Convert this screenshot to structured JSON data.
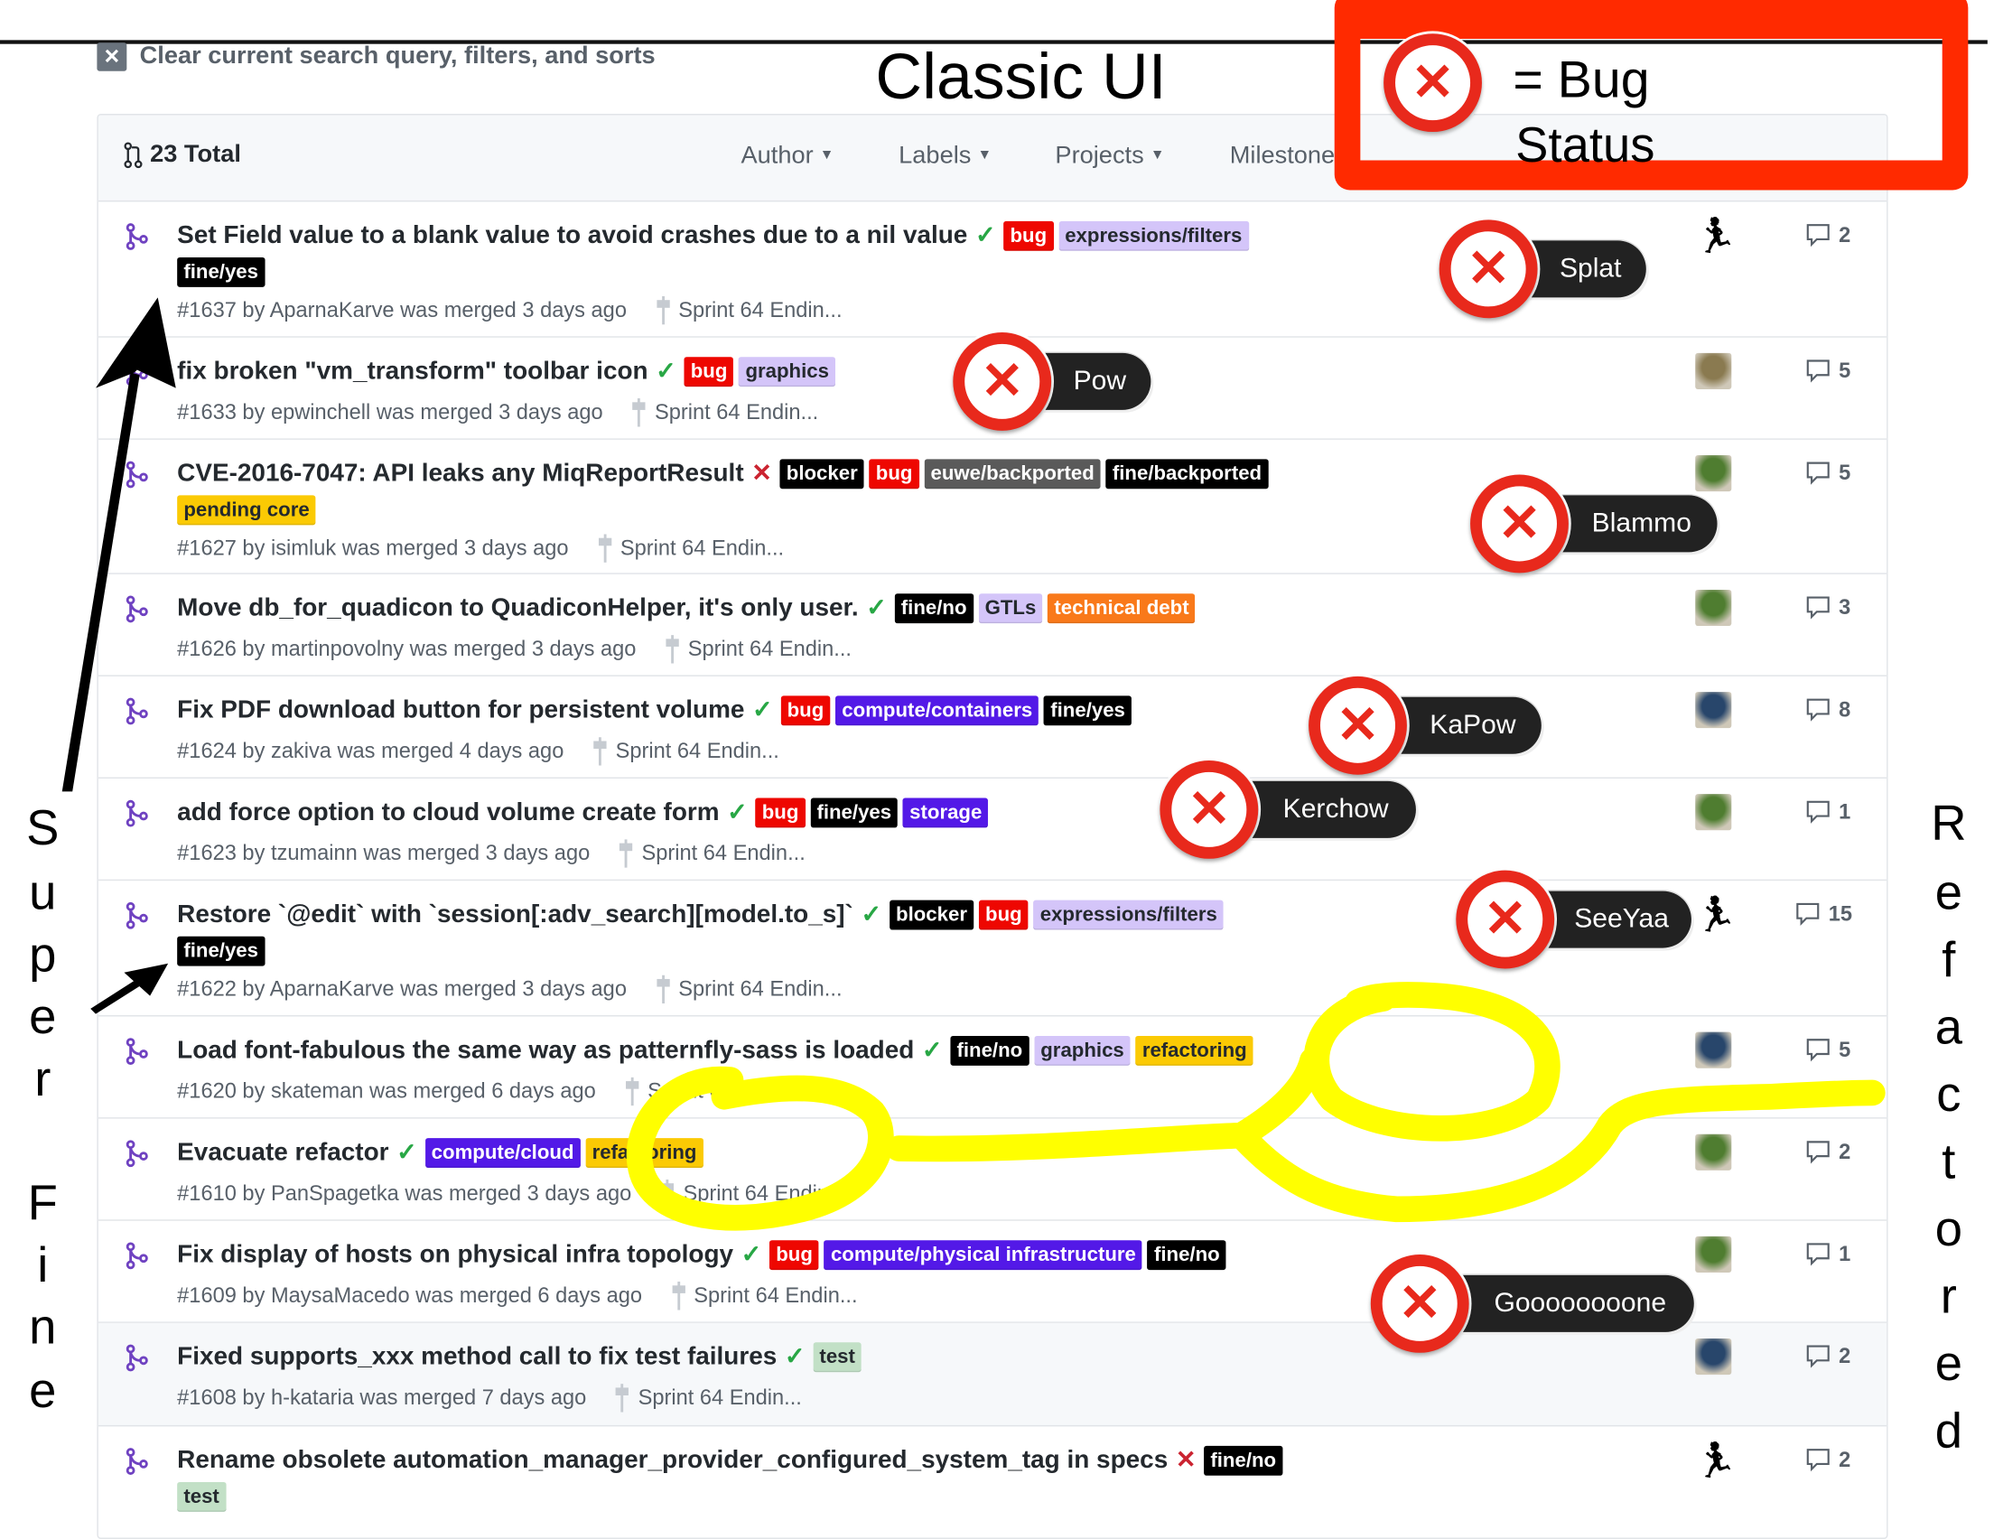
{
  "toolbar": {
    "clear_label": "Clear current search query, filters, and sorts",
    "clear_icon": "x-icon"
  },
  "annotation_title": "Classic UI",
  "legend": {
    "equals_label": "= Bug",
    "status_label": "Status",
    "color": "#ff2a00"
  },
  "header": {
    "total": "23 Total",
    "filters": [
      "Author",
      "Labels",
      "Projects",
      "Milestone"
    ]
  },
  "milestone": "Sprint 64 Endin...",
  "status_colors": {
    "success": "#28a745",
    "failure": "#cb2431"
  },
  "rows": [
    {
      "title": "Set Field value to a blank value to avoid crashes due to a nil value",
      "status": "success",
      "labels": [
        {
          "name": "bug",
          "bg": "#ee0701",
          "fg": "#fff"
        },
        {
          "name": "expressions/filters",
          "bg": "#d4c5f9",
          "fg": "#24292e"
        },
        {
          "name": "fine/yes",
          "bg": "#000000",
          "fg": "#fff"
        }
      ],
      "meta": "#1637 by AparnaKarve was merged 3 days ago",
      "avatar": "runner-icon",
      "comments": "2"
    },
    {
      "title": "fix broken \"vm_transform\" toolbar icon",
      "status": "success",
      "labels": [
        {
          "name": "bug",
          "bg": "#ee0701",
          "fg": "#fff"
        },
        {
          "name": "graphics",
          "bg": "#d4c5f9",
          "fg": "#24292e"
        }
      ],
      "meta": "#1633 by epwinchell was merged 3 days ago",
      "avatar": "photo",
      "comments": "5"
    },
    {
      "title": "CVE-2016-7047: API leaks any MiqReportResult",
      "status": "failure",
      "labels": [
        {
          "name": "blocker",
          "bg": "#000000",
          "fg": "#fff"
        },
        {
          "name": "bug",
          "bg": "#ee0701",
          "fg": "#fff"
        },
        {
          "name": "euwe/backported",
          "bg": "#5a5a5a",
          "fg": "#fff"
        },
        {
          "name": "fine/backported",
          "bg": "#000000",
          "fg": "#fff"
        },
        {
          "name": "pending core",
          "bg": "#fbca04",
          "fg": "#24292e"
        }
      ],
      "meta": "#1627 by isimluk was merged 3 days ago",
      "avatar": "photo",
      "comments": "5"
    },
    {
      "title": "Move db_for_quadicon to QuadiconHelper, it's only user.",
      "status": "success",
      "labels": [
        {
          "name": "fine/no",
          "bg": "#000000",
          "fg": "#fff"
        },
        {
          "name": "GTLs",
          "bg": "#d4c5f9",
          "fg": "#24292e"
        },
        {
          "name": "technical debt",
          "bg": "#f9791a",
          "fg": "#fff"
        }
      ],
      "meta": "#1626 by martinpovolny was merged 3 days ago",
      "avatar": "photo",
      "comments": "3"
    },
    {
      "title": "Fix PDF download button for persistent volume",
      "status": "success",
      "labels": [
        {
          "name": "bug",
          "bg": "#ee0701",
          "fg": "#fff"
        },
        {
          "name": "compute/containers",
          "bg": "#5319e7",
          "fg": "#fff"
        },
        {
          "name": "fine/yes",
          "bg": "#000000",
          "fg": "#fff"
        }
      ],
      "meta": "#1624 by zakiva was merged 4 days ago",
      "avatar": "photo",
      "comments": "8"
    },
    {
      "title": "add force option to cloud volume create form",
      "status": "success",
      "labels": [
        {
          "name": "bug",
          "bg": "#ee0701",
          "fg": "#fff"
        },
        {
          "name": "fine/yes",
          "bg": "#000000",
          "fg": "#fff"
        },
        {
          "name": "storage",
          "bg": "#5319e7",
          "fg": "#fff"
        }
      ],
      "meta": "#1623 by tzumainn was merged 3 days ago",
      "avatar": "photo",
      "comments": "1"
    },
    {
      "title": "Restore `@edit` with `session[:adv_search][model.to_s]`",
      "status": "success",
      "labels": [
        {
          "name": "blocker",
          "bg": "#000000",
          "fg": "#fff"
        },
        {
          "name": "bug",
          "bg": "#ee0701",
          "fg": "#fff"
        },
        {
          "name": "expressions/filters",
          "bg": "#d4c5f9",
          "fg": "#24292e"
        },
        {
          "name": "fine/yes",
          "bg": "#000000",
          "fg": "#fff"
        }
      ],
      "meta": "#1622 by AparnaKarve was merged 3 days ago",
      "avatar": "runner-icon",
      "comments": "15"
    },
    {
      "title": "Load font-fabulous the same way as patternfly-sass is loaded",
      "status": "success",
      "labels": [
        {
          "name": "fine/no",
          "bg": "#000000",
          "fg": "#fff"
        },
        {
          "name": "graphics",
          "bg": "#d4c5f9",
          "fg": "#24292e"
        },
        {
          "name": "refactoring",
          "bg": "#fbca04",
          "fg": "#24292e"
        }
      ],
      "meta": "#1620 by skateman was merged 6 days ago",
      "avatar": "photo",
      "comments": "5"
    },
    {
      "title": "Evacuate refactor",
      "status": "success",
      "labels": [
        {
          "name": "compute/cloud",
          "bg": "#5319e7",
          "fg": "#fff"
        },
        {
          "name": "refactoring",
          "bg": "#fbca04",
          "fg": "#24292e"
        }
      ],
      "meta": "#1610 by PanSpagetka was merged 3 days ago",
      "avatar": "photo",
      "comments": "2"
    },
    {
      "title": "Fix display of hosts on physical infra topology",
      "status": "success",
      "labels": [
        {
          "name": "bug",
          "bg": "#ee0701",
          "fg": "#fff"
        },
        {
          "name": "compute/physical infrastructure",
          "bg": "#5319e7",
          "fg": "#fff"
        },
        {
          "name": "fine/no",
          "bg": "#000000",
          "fg": "#fff"
        }
      ],
      "meta": "#1609 by MaysaMacedo was merged 6 days ago",
      "avatar": "photo",
      "comments": "1"
    },
    {
      "title": "Fixed supports_xxx method call to fix test failures",
      "status": "success",
      "labels": [
        {
          "name": "test",
          "bg": "#c2e0c6",
          "fg": "#24292e"
        }
      ],
      "meta": "#1608 by h-kataria was merged 7 days ago",
      "avatar": "photo",
      "comments": "2"
    },
    {
      "title": "Rename obsolete automation_manager_provider_configured_system_tag in specs",
      "status": "failure",
      "labels": [
        {
          "name": "fine/no",
          "bg": "#000000",
          "fg": "#fff"
        },
        {
          "name": "test",
          "bg": "#c2e0c6",
          "fg": "#24292e"
        }
      ],
      "meta": "",
      "avatar": "runner-icon",
      "comments": "2"
    }
  ],
  "callouts": [
    "Splat",
    "Pow",
    "Blammo",
    "KaPow",
    "Kerchow",
    "SeeYaa",
    "Goooooooone"
  ],
  "side_left": [
    "S",
    "u",
    "p",
    "e",
    "r",
    "F",
    "i",
    "n",
    "e"
  ],
  "side_right": [
    "R",
    "e",
    "f",
    "a",
    "c",
    "t",
    "o",
    "r",
    "e",
    "d"
  ],
  "highlight_color": "#ffff00"
}
